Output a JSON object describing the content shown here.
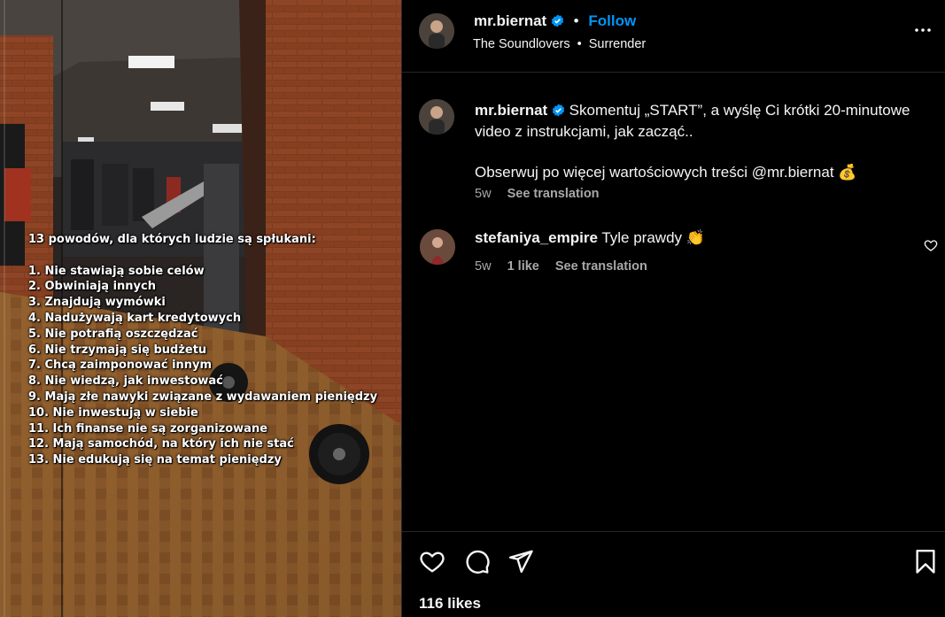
{
  "media": {
    "overlay_title": "13 powodów, dla których ludzie są spłukani:",
    "overlay_items": [
      "1. Nie stawiają sobie celów",
      "2. Obwiniają innych",
      "3. Znajdują wymówki",
      "4. Nadużywają kart kredytowych",
      "5. Nie potrafią oszczędzać",
      "6. Nie trzymają się budżetu",
      "7. Chcą zaimponować innym",
      "8. Nie wiedzą, jak inwestować",
      "9. Mają złe nawyki związane z wydawaniem pieniędzy",
      "10. Nie inwestują w siebie",
      "11. Ich finanse nie są zorganizowane",
      "12. Mają samochód, na który ich nie stać",
      "13. Nie edukują się na temat pieniędzy"
    ]
  },
  "header": {
    "username": "mr.biernat",
    "separator": "•",
    "follow_label": "Follow",
    "audio_artist": "The Soundlovers",
    "audio_separator": "•",
    "audio_track": "Surrender",
    "more_icon": "more-horizontal-icon"
  },
  "caption": {
    "username": "mr.biernat",
    "text_line1": "Skomentuj „START”, a wyślę Ci krótki 20-minutowe video z instrukcjami, jak zacząć..",
    "text_line2": "Obserwuj po więcej wartościowych treści @mr.biernat 💰",
    "time": "5w",
    "see_translation": "See translation"
  },
  "comment": {
    "username": "stefaniya_empire",
    "text": "Tyle prawdy 👏",
    "time": "5w",
    "likes": "1 like",
    "see_translation": "See translation"
  },
  "actions": {
    "likes_label": "116 likes"
  },
  "colors": {
    "background": "#000000",
    "link_blue": "#0095f6",
    "verified_blue": "#0095f6",
    "muted_text": "#a8a8a8",
    "divider": "#262626"
  }
}
